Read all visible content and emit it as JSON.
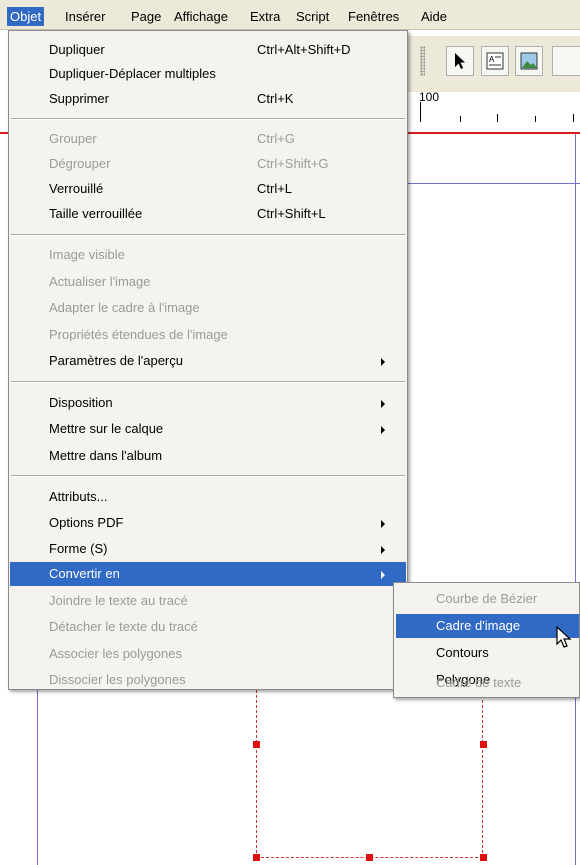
{
  "menubar": {
    "items": [
      "Objet",
      "Insérer",
      "Page",
      "Affichage",
      "Extra",
      "Script",
      "Fenêtres",
      "Aide"
    ]
  },
  "ruler": {
    "label": "100"
  },
  "menu": {
    "items": [
      {
        "label": "Dupliquer",
        "shortcut": "Ctrl+Alt+Shift+D",
        "enabled": true
      },
      {
        "label": "Dupliquer-Déplacer multiples",
        "shortcut": "",
        "enabled": true
      },
      {
        "label": "Supprimer",
        "shortcut": "Ctrl+K",
        "enabled": true
      },
      {
        "label": "Grouper",
        "shortcut": "Ctrl+G",
        "enabled": false
      },
      {
        "label": "Dégrouper",
        "shortcut": "Ctrl+Shift+G",
        "enabled": false
      },
      {
        "label": "Verrouillé",
        "shortcut": "Ctrl+L",
        "enabled": true
      },
      {
        "label": "Taille verrouillée",
        "shortcut": "Ctrl+Shift+L",
        "enabled": true
      },
      {
        "label": "Image visible",
        "shortcut": "",
        "enabled": false
      },
      {
        "label": "Actualiser l'image",
        "shortcut": "",
        "enabled": false
      },
      {
        "label": "Adapter le cadre à l'image",
        "shortcut": "",
        "enabled": false
      },
      {
        "label": "Propriétés étendues de l'image",
        "shortcut": "",
        "enabled": false
      },
      {
        "label": "Paramètres de l'aperçu",
        "shortcut": "",
        "enabled": true,
        "submenu": true
      },
      {
        "label": "Disposition",
        "shortcut": "",
        "enabled": true,
        "submenu": true
      },
      {
        "label": "Mettre sur le calque",
        "shortcut": "",
        "enabled": true,
        "submenu": true
      },
      {
        "label": "Mettre dans l'album",
        "shortcut": "",
        "enabled": true
      },
      {
        "label": "Attributs...",
        "shortcut": "",
        "enabled": true
      },
      {
        "label": "Options PDF",
        "shortcut": "",
        "enabled": true,
        "submenu": true
      },
      {
        "label": "Forme (S)",
        "shortcut": "",
        "enabled": true,
        "submenu": true
      },
      {
        "label": "Convertir en",
        "shortcut": "",
        "enabled": true,
        "submenu": true,
        "highlighted": true
      },
      {
        "label": "Joindre le texte au tracé",
        "shortcut": "",
        "enabled": false
      },
      {
        "label": "Détacher le texte du tracé",
        "shortcut": "",
        "enabled": false
      },
      {
        "label": "Associer les polygones",
        "shortcut": "",
        "enabled": false
      },
      {
        "label": "Dissocier les polygones",
        "shortcut": "",
        "enabled": false
      }
    ]
  },
  "submenu": {
    "items": [
      {
        "label": "Courbe de Bézier",
        "enabled": false
      },
      {
        "label": "Cadre d'image",
        "enabled": true,
        "highlighted": true
      },
      {
        "label": "Contours",
        "enabled": true
      },
      {
        "label": "Polygone",
        "enabled": true
      },
      {
        "label": "Cadre de texte",
        "enabled": false
      }
    ]
  },
  "icons": [
    "arrow-pointer-icon",
    "text-frame-icon",
    "image-frame-icon",
    "mouse-cursor-icon"
  ],
  "colors": {
    "highlight": "#316ac5",
    "guide": "#7070d0",
    "margin": "#d51b1b"
  }
}
